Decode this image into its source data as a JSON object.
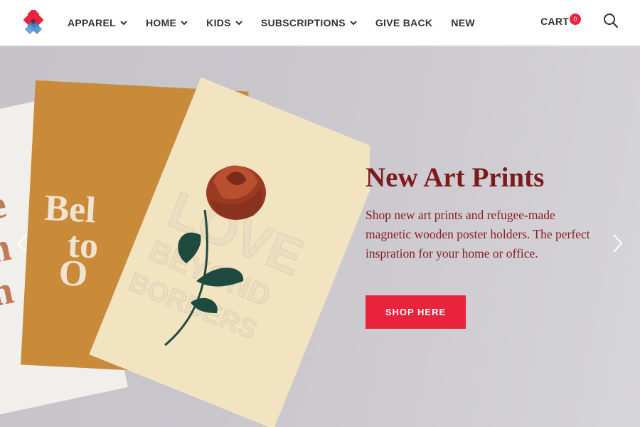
{
  "nav": {
    "items": [
      {
        "label": "APPAREL",
        "dropdown": true
      },
      {
        "label": "HOME",
        "dropdown": true
      },
      {
        "label": "KIDS",
        "dropdown": true
      },
      {
        "label": "SUBSCRIPTIONS",
        "dropdown": true
      },
      {
        "label": "GIVE BACK",
        "dropdown": false
      },
      {
        "label": "NEW",
        "dropdown": false
      }
    ],
    "cart_label": "CART",
    "cart_count": "0",
    "search_icon": "search-icon"
  },
  "hero": {
    "title": "New Art Prints",
    "description": "Shop new art prints and refugee-made magnetic wooden poster holders. The perfect inspration for your home or office.",
    "cta_label": "SHOP HERE",
    "prev_icon": "chevron-left-icon",
    "next_icon": "chevron-right-icon",
    "art_text": {
      "front_card": [
        "LOVE",
        "BEYOND",
        "BORDERS"
      ],
      "middle_card": [
        "Bel",
        "to",
        "O"
      ],
      "back_card": [
        "Ne",
        "on",
        "th"
      ]
    }
  },
  "colors": {
    "accent": "#e8233b",
    "title": "#7d1a1c",
    "nav_text": "#333333"
  }
}
